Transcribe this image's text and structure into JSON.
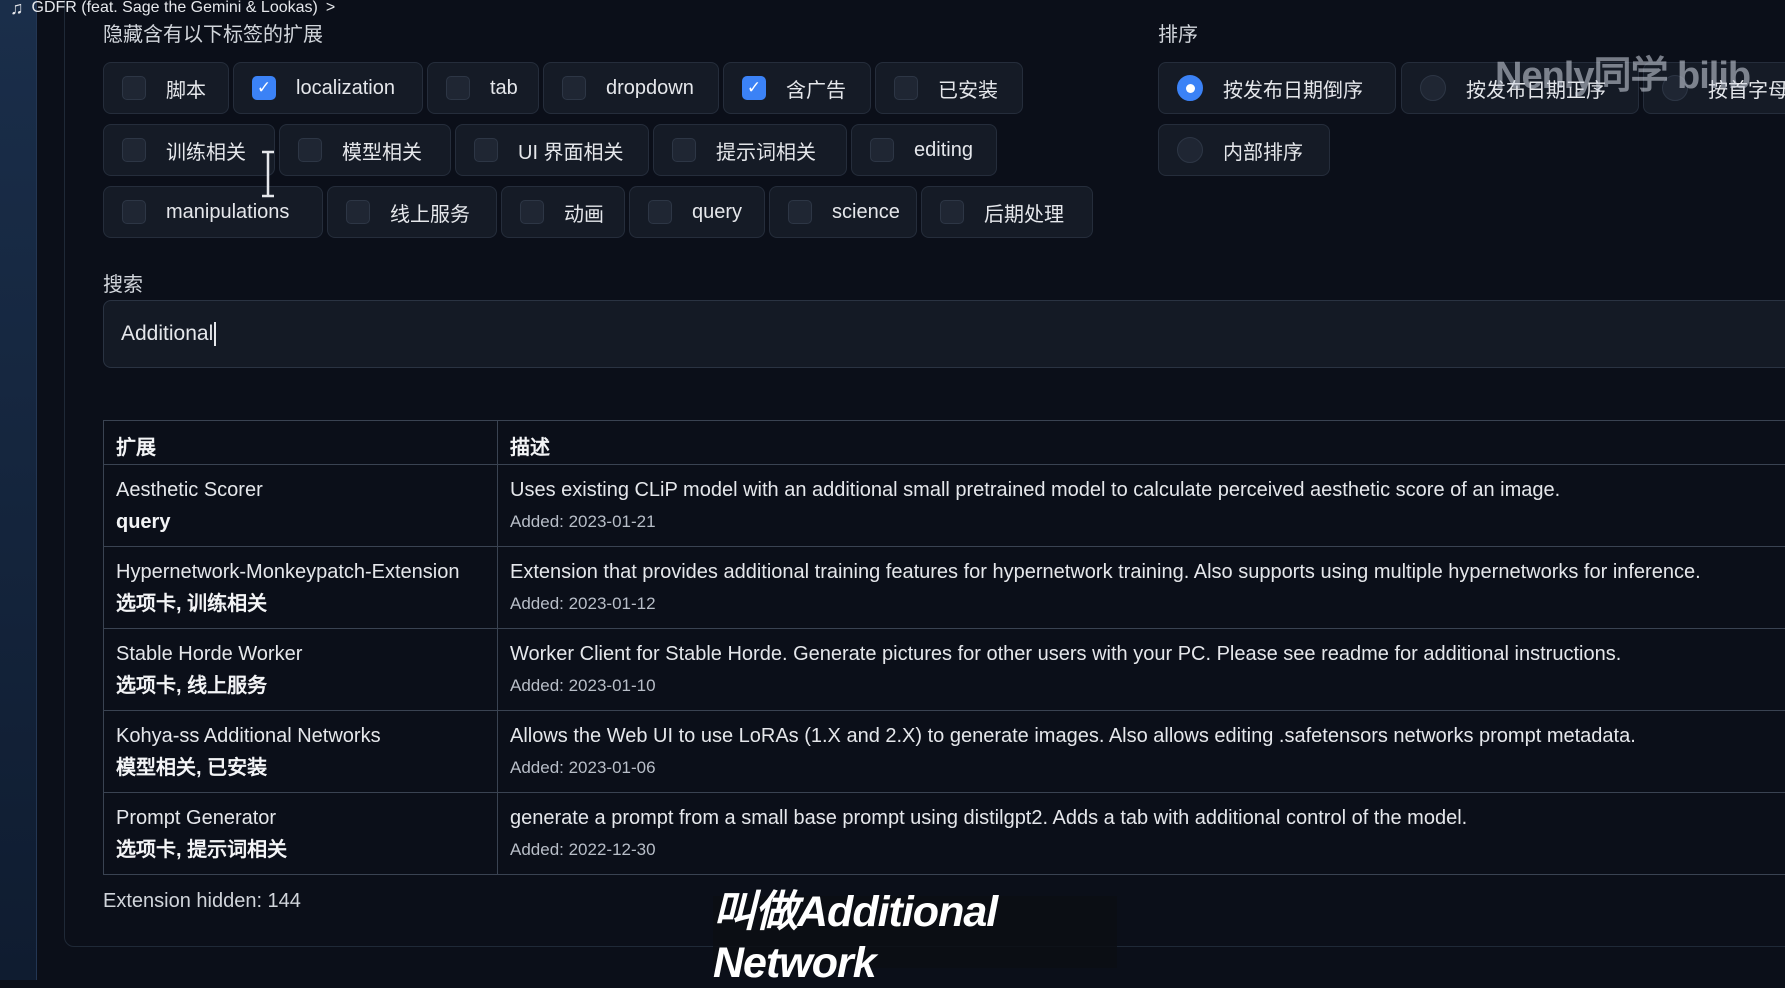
{
  "music_bar": {
    "track": "GDFR (feat. Sage the Gemini & Lookas)",
    "chevron": ">"
  },
  "filters": {
    "hide_label": "隐藏含有以下标签的扩展",
    "tags": [
      {
        "label": "脚本",
        "checked": false
      },
      {
        "label": "localization",
        "checked": true
      },
      {
        "label": "tab",
        "checked": false
      },
      {
        "label": "dropdown",
        "checked": false
      },
      {
        "label": "含广告",
        "checked": true
      },
      {
        "label": "已安装",
        "checked": false
      },
      {
        "label": "训练相关",
        "checked": false
      },
      {
        "label": "模型相关",
        "checked": false
      },
      {
        "label": "UI 界面相关",
        "checked": false
      },
      {
        "label": "提示词相关",
        "checked": false
      },
      {
        "label": "editing",
        "checked": false
      },
      {
        "label": "manipulations",
        "checked": false
      },
      {
        "label": "线上服务",
        "checked": false
      },
      {
        "label": "动画",
        "checked": false
      },
      {
        "label": "query",
        "checked": false
      },
      {
        "label": "science",
        "checked": false
      },
      {
        "label": "后期处理",
        "checked": false
      }
    ]
  },
  "sort": {
    "label": "排序",
    "options": [
      {
        "label": "按发布日期倒序",
        "selected": true
      },
      {
        "label": "按发布日期正序",
        "selected": false
      },
      {
        "label": "按首字母",
        "selected": false
      },
      {
        "label": "内部排序",
        "selected": false
      }
    ]
  },
  "search": {
    "label": "搜索",
    "value": "Additional"
  },
  "table": {
    "headers": [
      "扩展",
      "描述"
    ],
    "rows": [
      {
        "name": "Aesthetic Scorer",
        "tags": "query",
        "description": "Uses existing CLiP model with an additional small pretrained model to calculate perceived aesthetic score of an image.",
        "added": "Added: 2023-01-21"
      },
      {
        "name": "Hypernetwork-Monkeypatch-Extension",
        "tags": "选项卡, 训练相关",
        "description": "Extension that provides additional training features for hypernetwork training. Also supports using multiple hypernetworks for inference.",
        "added": "Added: 2023-01-12"
      },
      {
        "name": "Stable Horde Worker",
        "tags": "选项卡, 线上服务",
        "description": "Worker Client for Stable Horde. Generate pictures for other users with your PC. Please see readme for additional instructions.",
        "added": "Added: 2023-01-10"
      },
      {
        "name": "Kohya-ss Additional Networks",
        "tags": "模型相关, 已安装",
        "description": "Allows the Web UI to use LoRAs (1.X and 2.X) to generate images. Also allows editing .safetensors networks prompt metadata.",
        "added": "Added: 2023-01-06"
      },
      {
        "name": "Prompt Generator",
        "tags": "选项卡, 提示词相关",
        "description": "generate a prompt from a small base prompt using distilgpt2. Adds a tab with additional control of the model.",
        "added": "Added: 2022-12-30"
      }
    ]
  },
  "footer": {
    "hidden_count": "Extension hidden: 144"
  },
  "overlay": {
    "watermark": "Nenly同学 bilib",
    "subtitle": "叫做Additional Network"
  },
  "colors": {
    "accent": "#3b82f6",
    "background": "#0b0f19",
    "chip": "#151b26"
  }
}
